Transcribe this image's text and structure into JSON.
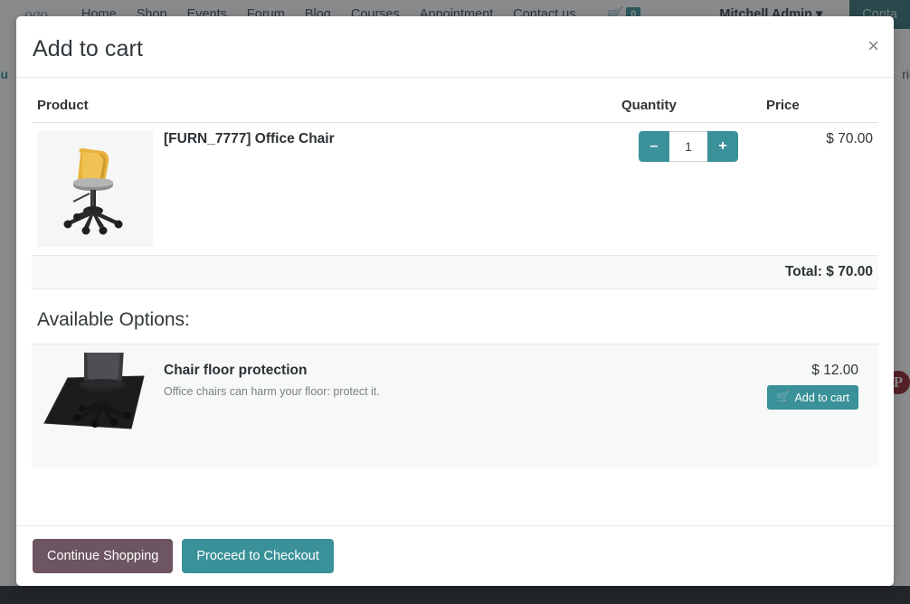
{
  "background": {
    "logo_text": "ogo",
    "nav_links": [
      "Home",
      "Shop",
      "Events",
      "Forum",
      "Blog",
      "Courses",
      "Appointment",
      "Contact us"
    ],
    "cart_icon": "shopping-cart-icon",
    "cart_count": "0",
    "user_menu": "Mitchell Admin ▾",
    "cta_label": "Conta",
    "breadcrumb_left": "du",
    "breadcrumb_right": "ric",
    "pinterest_glyph": "P"
  },
  "modal": {
    "title": "Add to cart",
    "close_label": "×",
    "table": {
      "headers": {
        "product": "Product",
        "quantity": "Quantity",
        "price": "Price"
      },
      "rows": [
        {
          "name": "[FURN_7777] Office Chair",
          "image": "office-chair-yellow",
          "quantity": "1",
          "minus_label": "–",
          "plus_label": "+",
          "price": "$ 70.00"
        }
      ],
      "total_label": "Total: $ 70.00"
    },
    "options": {
      "heading": "Available Options:",
      "items": [
        {
          "name": "Chair floor protection",
          "description": "Office chairs can harm your floor: protect it.",
          "image": "chair-floor-mat",
          "price": "$ 12.00",
          "add_label": "Add to cart",
          "add_icon": "shopping-cart-icon"
        }
      ]
    },
    "footer": {
      "continue_label": "Continue Shopping",
      "checkout_label": "Proceed to Checkout"
    }
  },
  "colors": {
    "teal": "#3a9199",
    "mauve": "#6d5561",
    "cta_teal": "#2d6d6f",
    "pinterest_red": "#8f1420"
  }
}
